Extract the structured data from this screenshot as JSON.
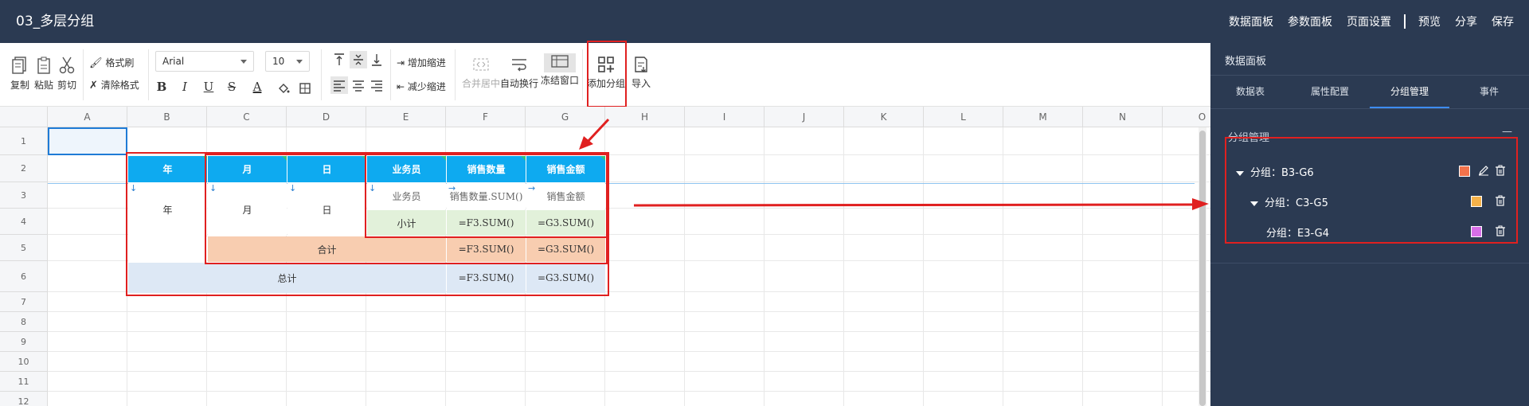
{
  "app": {
    "title": "03_多层分组",
    "actions": [
      "数据面板",
      "参数面板",
      "页面设置",
      "预览",
      "分享",
      "保存"
    ]
  },
  "toolbar": {
    "copy": "复制",
    "paste": "粘贴",
    "cut": "剪切",
    "format_painter": "格式刷",
    "clear_format": "清除格式",
    "font": "Arial",
    "font_size": "10",
    "bold": "B",
    "italic": "I",
    "underline": "U",
    "strike": "S",
    "font_color": "A",
    "indent_increase": "增加缩进",
    "indent_decrease": "减少缩进",
    "merge_center": "合并居中",
    "auto_wrap": "自动换行",
    "freeze": "冻结窗口",
    "add_group": "添加分组",
    "import": "导入"
  },
  "grid": {
    "columns": [
      "A",
      "B",
      "C",
      "D",
      "E",
      "F",
      "G",
      "H",
      "I",
      "J",
      "K",
      "L",
      "M",
      "N",
      "O"
    ],
    "rows": [
      "1",
      "2",
      "3",
      "4",
      "5",
      "6",
      "7",
      "8",
      "9",
      "10",
      "11",
      "12"
    ],
    "cells": {
      "year_hdr": "年",
      "month_hdr": "月",
      "day_hdr": "日",
      "salesman_hdr": "业务员",
      "qty_hdr": "销售数量",
      "amt_hdr": "销售金额",
      "year": "年",
      "month": "月",
      "day": "日",
      "salesman": "业务员",
      "qty": "销售数量.SUM()",
      "amt": "销售金额",
      "subtotal": "小计",
      "sub_qty": "=F3.SUM()",
      "sub_amt": "=G3.SUM()",
      "total_label": "合计",
      "total_qty": "=F3.SUM()",
      "total_amt": "=G3.SUM()",
      "grand_label": "总计",
      "grand_qty": "=F3.SUM()",
      "grand_amt": "=G3.SUM()"
    }
  },
  "right_panel": {
    "title": "数据面板",
    "tabs": [
      "数据表",
      "属性配置",
      "分组管理",
      "事件"
    ],
    "active_tab": "分组管理",
    "section_title": "分组管理",
    "collapse": "—",
    "groups": [
      {
        "label": "分组：B3-G6",
        "color": "#f2724b",
        "level": 0
      },
      {
        "label": "分组：C3-G5",
        "color": "#f6b24a",
        "level": 1
      },
      {
        "label": "分组：E3-G4",
        "color": "#d86ee8",
        "level": 2
      }
    ]
  },
  "colors": {
    "header_blue": "#0eaaf0",
    "dark_panel": "#2b3a52",
    "highlight_red": "#e02020"
  }
}
